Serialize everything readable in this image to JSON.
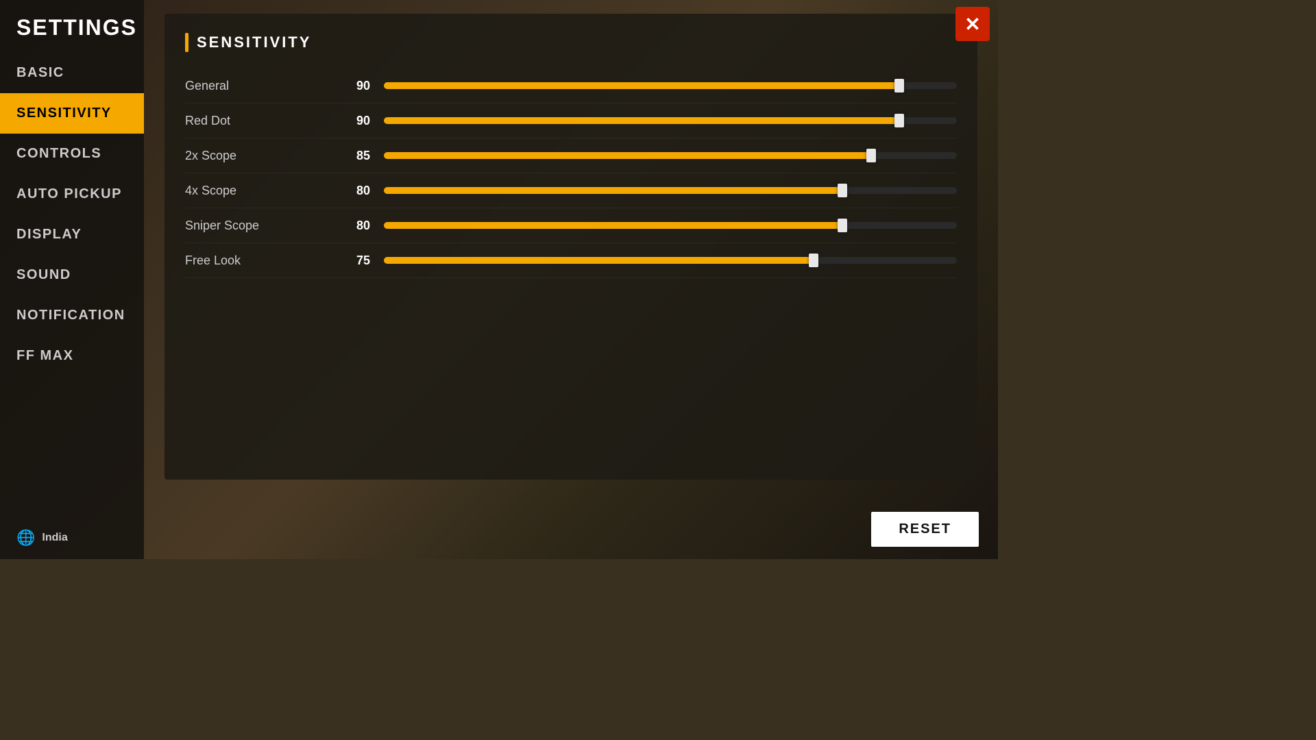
{
  "app": {
    "title": "SETTINGS"
  },
  "sidebar": {
    "items": [
      {
        "id": "basic",
        "label": "BASIC",
        "active": false
      },
      {
        "id": "sensitivity",
        "label": "SENSITIVITY",
        "active": true
      },
      {
        "id": "controls",
        "label": "CONTROLS",
        "active": false
      },
      {
        "id": "auto-pickup",
        "label": "AUTO PICKUP",
        "active": false
      },
      {
        "id": "display",
        "label": "DISPLAY",
        "active": false
      },
      {
        "id": "sound",
        "label": "SOUND",
        "active": false
      },
      {
        "id": "notification",
        "label": "NOTIFICATION",
        "active": false
      },
      {
        "id": "ff-max",
        "label": "FF MAX",
        "active": false
      }
    ],
    "footer": {
      "region": "India"
    }
  },
  "main": {
    "section_title": "SENSITIVITY",
    "sliders": [
      {
        "label": "General",
        "value": 90,
        "percent": 90
      },
      {
        "label": "Red Dot",
        "value": 90,
        "percent": 90
      },
      {
        "label": "2x Scope",
        "value": 85,
        "percent": 85
      },
      {
        "label": "4x Scope",
        "value": 80,
        "percent": 80
      },
      {
        "label": "Sniper Scope",
        "value": 80,
        "percent": 80
      },
      {
        "label": "Free Look",
        "value": 75,
        "percent": 75
      }
    ]
  },
  "buttons": {
    "close_label": "✕",
    "reset_label": "RESET"
  },
  "colors": {
    "accent": "#f5a800",
    "active_nav_bg": "#f5a800",
    "active_nav_text": "#000000",
    "close_bg": "#cc2200"
  }
}
